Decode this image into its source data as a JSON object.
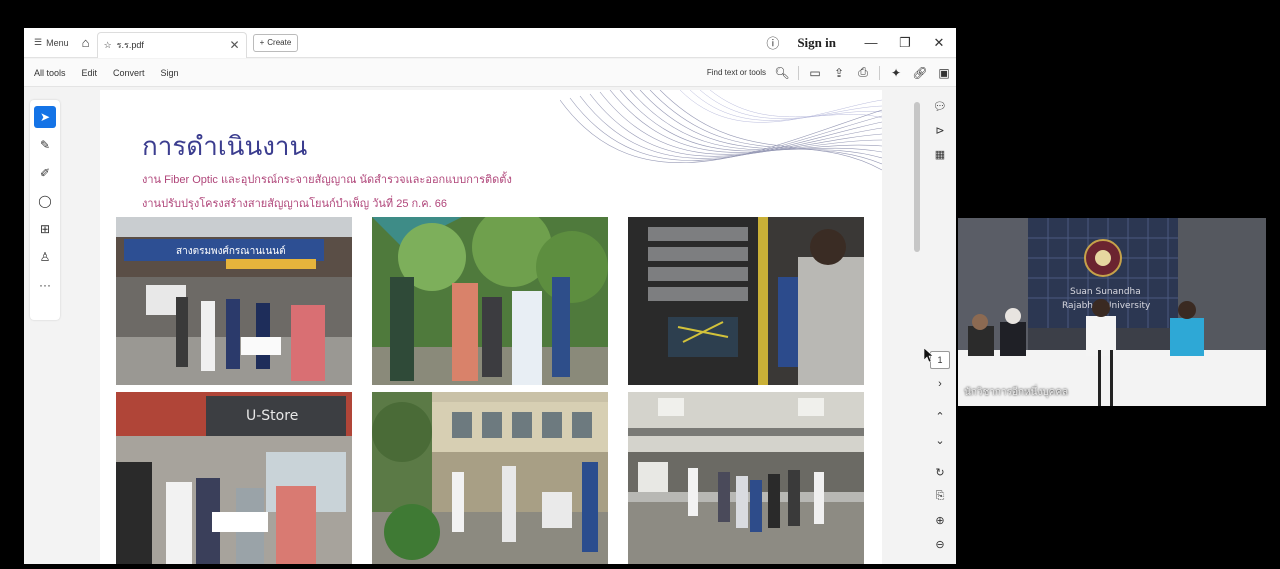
{
  "titlebar": {
    "menu_label": "Menu",
    "tab_filename": "ร.ร.pdf",
    "create_label": "Create",
    "signin_label": "Sign in"
  },
  "toolbar": {
    "items": [
      "All tools",
      "Edit",
      "Convert",
      "Sign"
    ],
    "find_label": "Find text or tools"
  },
  "document": {
    "title": "การดำเนินงาน",
    "line1": "งาน Fiber Optic และอุปกรณ์กระจายสัญญาณ นัดสำรวจและออกแบบการติดตั้ง",
    "line2": "งานปรับปรุงโครงสร้างสายสัญญาณโยนก์บำเพ็ญ วันที่ 25 ก.ค. 66",
    "photo1_sign": "สางตรมพงศ์กรณานเนนต์",
    "photo4_sign": "U-Store"
  },
  "navigation": {
    "page_number": "1"
  },
  "video": {
    "logo_text1": "Suan Sunandha",
    "logo_text2": "Rajabhat University",
    "caption": "นักวิชาการอีกหนึ่งบุคคล"
  },
  "icons": {
    "menu": "hamburger-icon",
    "home": "home-icon",
    "star": "star-icon",
    "help": "help-icon",
    "search": "search-icon"
  },
  "colors": {
    "title": "#3b3d8f",
    "subtitle": "#b0467a",
    "accent": "#1473e6"
  }
}
